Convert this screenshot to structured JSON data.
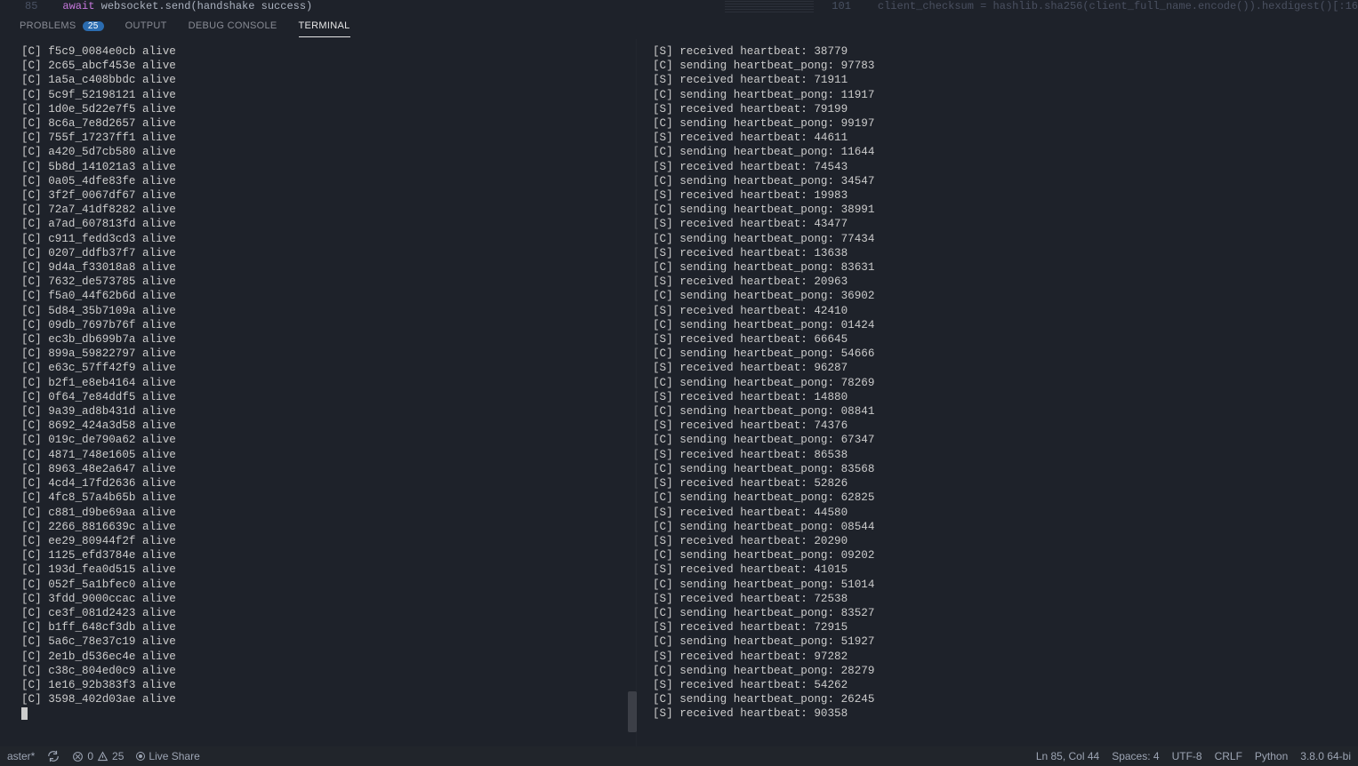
{
  "editor": {
    "left_linenum": "85",
    "left_code_await": "await",
    "left_code_rest": " websocket.send(handshake success)",
    "right_linenum": "101",
    "right_code": "client_checksum = hashlib.sha256(client_full_name.encode()).hexdigest()[:16"
  },
  "panel": {
    "problems_label": "PROBLEMS",
    "problems_badge": "25",
    "output_label": "OUTPUT",
    "debug_label": "DEBUG CONSOLE",
    "terminal_label": "TERMINAL"
  },
  "terminal_left": [
    "[C] f5c9_0084e0cb alive",
    "[C] 2c65_abcf453e alive",
    "[C] 1a5a_c408bbdc alive",
    "[C] 5c9f_52198121 alive",
    "[C] 1d0e_5d22e7f5 alive",
    "[C] 8c6a_7e8d2657 alive",
    "[C] 755f_17237ff1 alive",
    "[C] a420_5d7cb580 alive",
    "[C] 5b8d_141021a3 alive",
    "[C] 0a05_4dfe83fe alive",
    "[C] 3f2f_0067df67 alive",
    "[C] 72a7_41df8282 alive",
    "[C] a7ad_607813fd alive",
    "[C] c911_fedd3cd3 alive",
    "[C] 0207_ddfb37f7 alive",
    "[C] 9d4a_f33018a8 alive",
    "[C] 7632_de573785 alive",
    "[C] f5a0_44f62b6d alive",
    "[C] 5d84_35b7109a alive",
    "[C] 09db_7697b76f alive",
    "[C] ec3b_db699b7a alive",
    "[C] 899a_59822797 alive",
    "[C] e63c_57ff42f9 alive",
    "[C] b2f1_e8eb4164 alive",
    "[C] 0f64_7e84ddf5 alive",
    "[C] 9a39_ad8b431d alive",
    "[C] 8692_424a3d58 alive",
    "[C] 019c_de790a62 alive",
    "[C] 4871_748e1605 alive",
    "[C] 8963_48e2a647 alive",
    "[C] 4cd4_17fd2636 alive",
    "[C] 4fc8_57a4b65b alive",
    "[C] c881_d9be69aa alive",
    "[C] 2266_8816639c alive",
    "[C] ee29_80944f2f alive",
    "[C] 1125_efd3784e alive",
    "[C] 193d_fea0d515 alive",
    "[C] 052f_5a1bfec0 alive",
    "[C] 3fdd_9000ccac alive",
    "[C] ce3f_081d2423 alive",
    "[C] b1ff_648cf3db alive",
    "[C] 5a6c_78e37c19 alive",
    "[C] 2e1b_d536ec4e alive",
    "[C] c38c_804ed0c9 alive",
    "[C] 1e16_92b383f3 alive",
    "[C] 3598_402d03ae alive"
  ],
  "terminal_right": [
    "[S] received heartbeat: 38779",
    "[C] sending heartbeat_pong: 97783",
    "[S] received heartbeat: 71911",
    "[C] sending heartbeat_pong: 11917",
    "[S] received heartbeat: 79199",
    "[C] sending heartbeat_pong: 99197",
    "[S] received heartbeat: 44611",
    "[C] sending heartbeat_pong: 11644",
    "[S] received heartbeat: 74543",
    "[C] sending heartbeat_pong: 34547",
    "[S] received heartbeat: 19983",
    "[C] sending heartbeat_pong: 38991",
    "[S] received heartbeat: 43477",
    "[C] sending heartbeat_pong: 77434",
    "[S] received heartbeat: 13638",
    "[C] sending heartbeat_pong: 83631",
    "[S] received heartbeat: 20963",
    "[C] sending heartbeat_pong: 36902",
    "[S] received heartbeat: 42410",
    "[C] sending heartbeat_pong: 01424",
    "[S] received heartbeat: 66645",
    "[C] sending heartbeat_pong: 54666",
    "[S] received heartbeat: 96287",
    "[C] sending heartbeat_pong: 78269",
    "[S] received heartbeat: 14880",
    "[C] sending heartbeat_pong: 08841",
    "[S] received heartbeat: 74376",
    "[C] sending heartbeat_pong: 67347",
    "[S] received heartbeat: 86538",
    "[C] sending heartbeat_pong: 83568",
    "[S] received heartbeat: 52826",
    "[C] sending heartbeat_pong: 62825",
    "[S] received heartbeat: 44580",
    "[C] sending heartbeat_pong: 08544",
    "[S] received heartbeat: 20290",
    "[C] sending heartbeat_pong: 09202",
    "[S] received heartbeat: 41015",
    "[C] sending heartbeat_pong: 51014",
    "[S] received heartbeat: 72538",
    "[C] sending heartbeat_pong: 83527",
    "[S] received heartbeat: 72915",
    "[C] sending heartbeat_pong: 51927",
    "[S] received heartbeat: 97282",
    "[C] sending heartbeat_pong: 28279",
    "[S] received heartbeat: 54262",
    "[C] sending heartbeat_pong: 26245",
    "[S] received heartbeat: 90358"
  ],
  "status": {
    "branch_frag": "aster*",
    "errors": "0",
    "warnings": "25",
    "live_share": "Live Share",
    "ln_col": "Ln 85, Col 44",
    "spaces": "Spaces: 4",
    "encoding": "UTF-8",
    "eol": "CRLF",
    "lang": "Python",
    "interp": "3.8.0 64-bi"
  }
}
